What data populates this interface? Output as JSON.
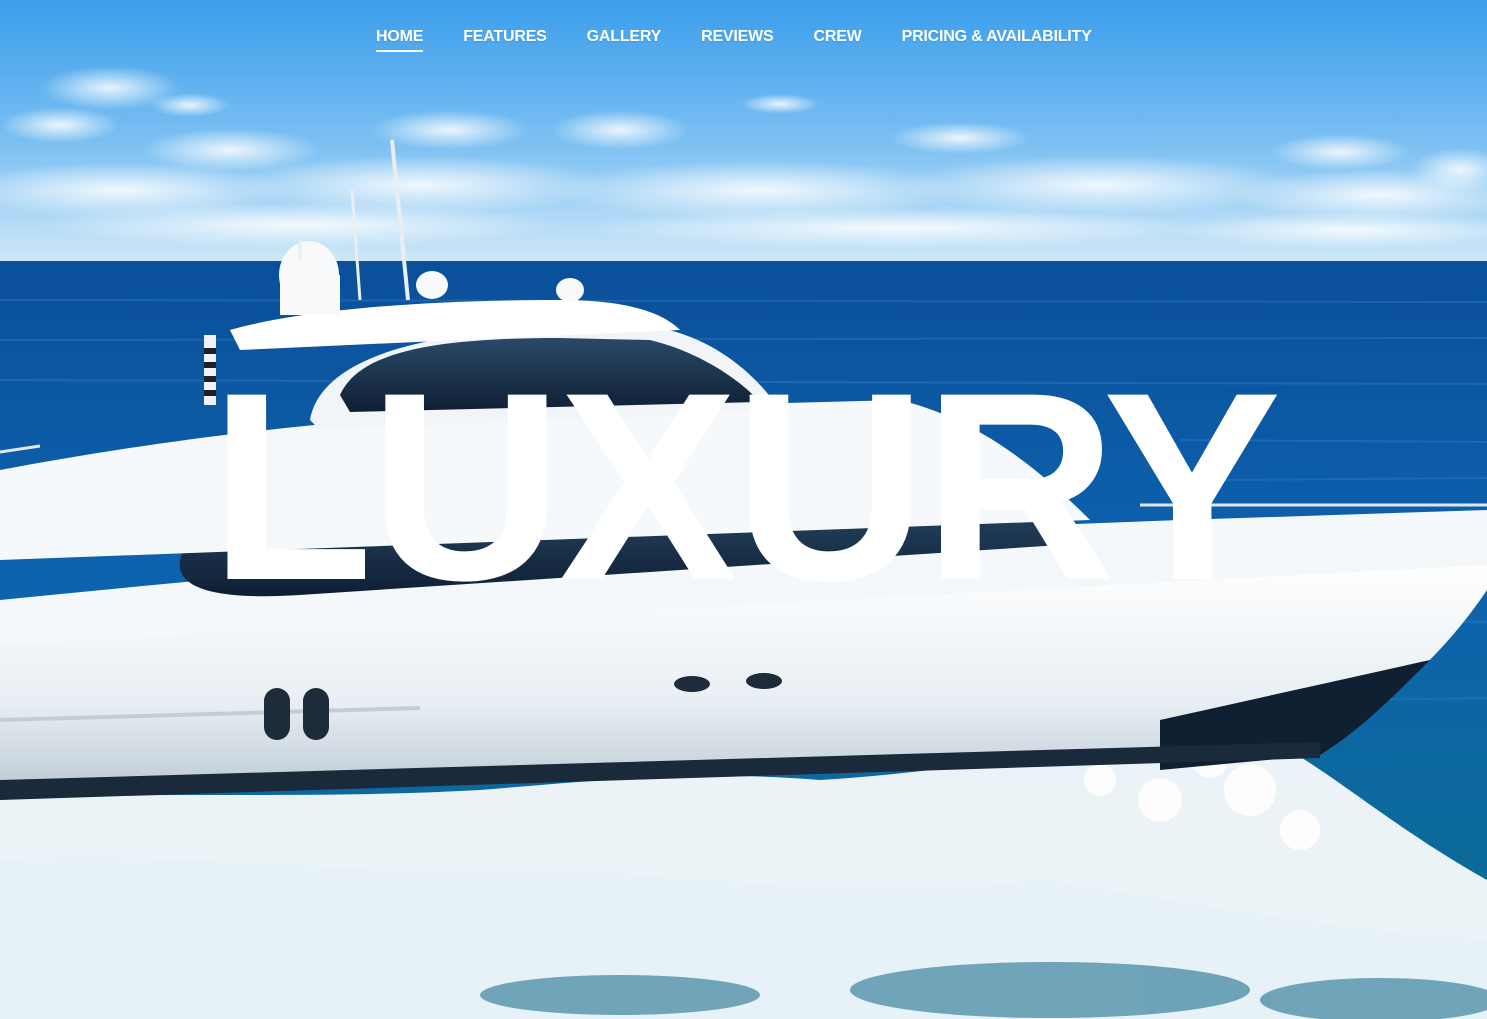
{
  "nav": {
    "items": [
      {
        "label": "HOME",
        "active": true
      },
      {
        "label": "FEATURES",
        "active": false
      },
      {
        "label": "GALLERY",
        "active": false
      },
      {
        "label": "REVIEWS",
        "active": false
      },
      {
        "label": "CREW",
        "active": false
      },
      {
        "label": "PRICING & AVAILABILITY",
        "active": false
      }
    ]
  },
  "hero": {
    "title": "LUXURY",
    "background": "photo of a white luxury motor yacht cruising on blue ocean with spray",
    "colors": {
      "sky_top": "#3fa2ee",
      "sky_horizon": "#c9e6f9",
      "ocean": "#0b5ea8",
      "hull": "#f3f7fa",
      "text": "#ffffff"
    }
  }
}
